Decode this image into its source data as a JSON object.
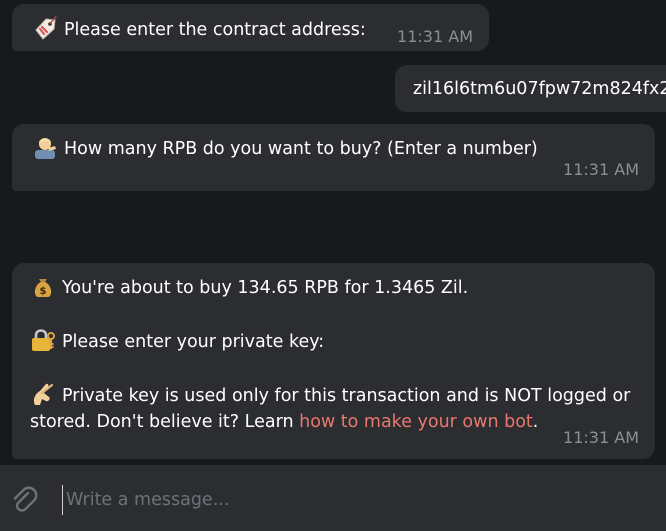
{
  "messages": [
    {
      "emoji": "label-tag-icon",
      "text": "Please enter the contract address:",
      "time": "11:31 AM"
    },
    {
      "text": "zil16l6tm6u07fpw72m824fx2"
    },
    {
      "emoji": "person-bowing-icon",
      "text": "How many RPB do you want to buy? (Enter a number)",
      "time": "11:31 AM"
    },
    {
      "line1_emoji": "money-bag-icon",
      "line1": "You're about to buy 134.65 RPB for 1.3465 Zil.",
      "line2_emoji": "locked-with-key-icon",
      "line2": "Please enter your private key:",
      "line3_emoji": "shushing-hand-icon",
      "line3_text": "Private key is used only for this transaction and is NOT logged or stored. Don't believe it? Learn ",
      "line3_link": "how to make your own bot",
      "line3_end": ".",
      "time": "11:31 AM"
    }
  ],
  "composer": {
    "placeholder": "Write a message..."
  },
  "colors": {
    "chat_bg": "#17191d",
    "bubble_bg": "#2b2d31",
    "link": "#e8786e",
    "time": "#8a8f96"
  }
}
